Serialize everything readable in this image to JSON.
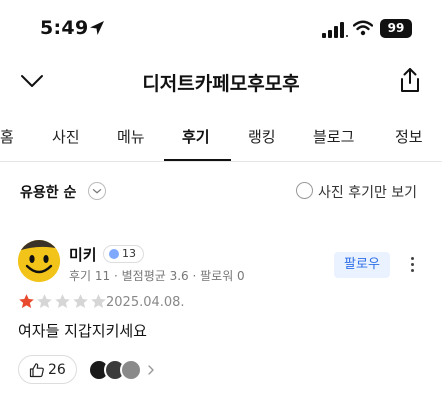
{
  "status_bar": {
    "time": "5:49",
    "battery": "99",
    "icons": [
      "location-arrow-icon",
      "signal-icon",
      "wifi-icon",
      "battery-icon"
    ]
  },
  "header": {
    "title": "디저트카페모후모후",
    "back_icon": "chevron-down-icon",
    "share_icon": "share-icon"
  },
  "tabs": [
    {
      "label": "홈",
      "active": false
    },
    {
      "label": "사진",
      "active": false
    },
    {
      "label": "메뉴",
      "active": false
    },
    {
      "label": "후기",
      "active": true
    },
    {
      "label": "랭킹",
      "active": false
    },
    {
      "label": "블로그",
      "active": false
    },
    {
      "label": "정보",
      "active": false
    }
  ],
  "filter": {
    "sort_label": "유용한 순",
    "photo_only_label": "사진 후기만 보기",
    "photo_only_checked": false
  },
  "review": {
    "username": "미키",
    "level": "13",
    "meta": "후기 11 · 별점평균 3.6 · 팔로워 0",
    "follow_label": "팔로우",
    "rating": 1,
    "max_rating": 5,
    "date": "2025.04.08.",
    "text": "여자들 지갑지키세요",
    "like_count": "26"
  },
  "colors": {
    "accent_blue": "#2f6fe8",
    "follow_bg": "#eaf2ff",
    "star_on": "#e84a2e",
    "star_off": "#d6d6d6",
    "avatar_yellow": "#f2c318"
  }
}
